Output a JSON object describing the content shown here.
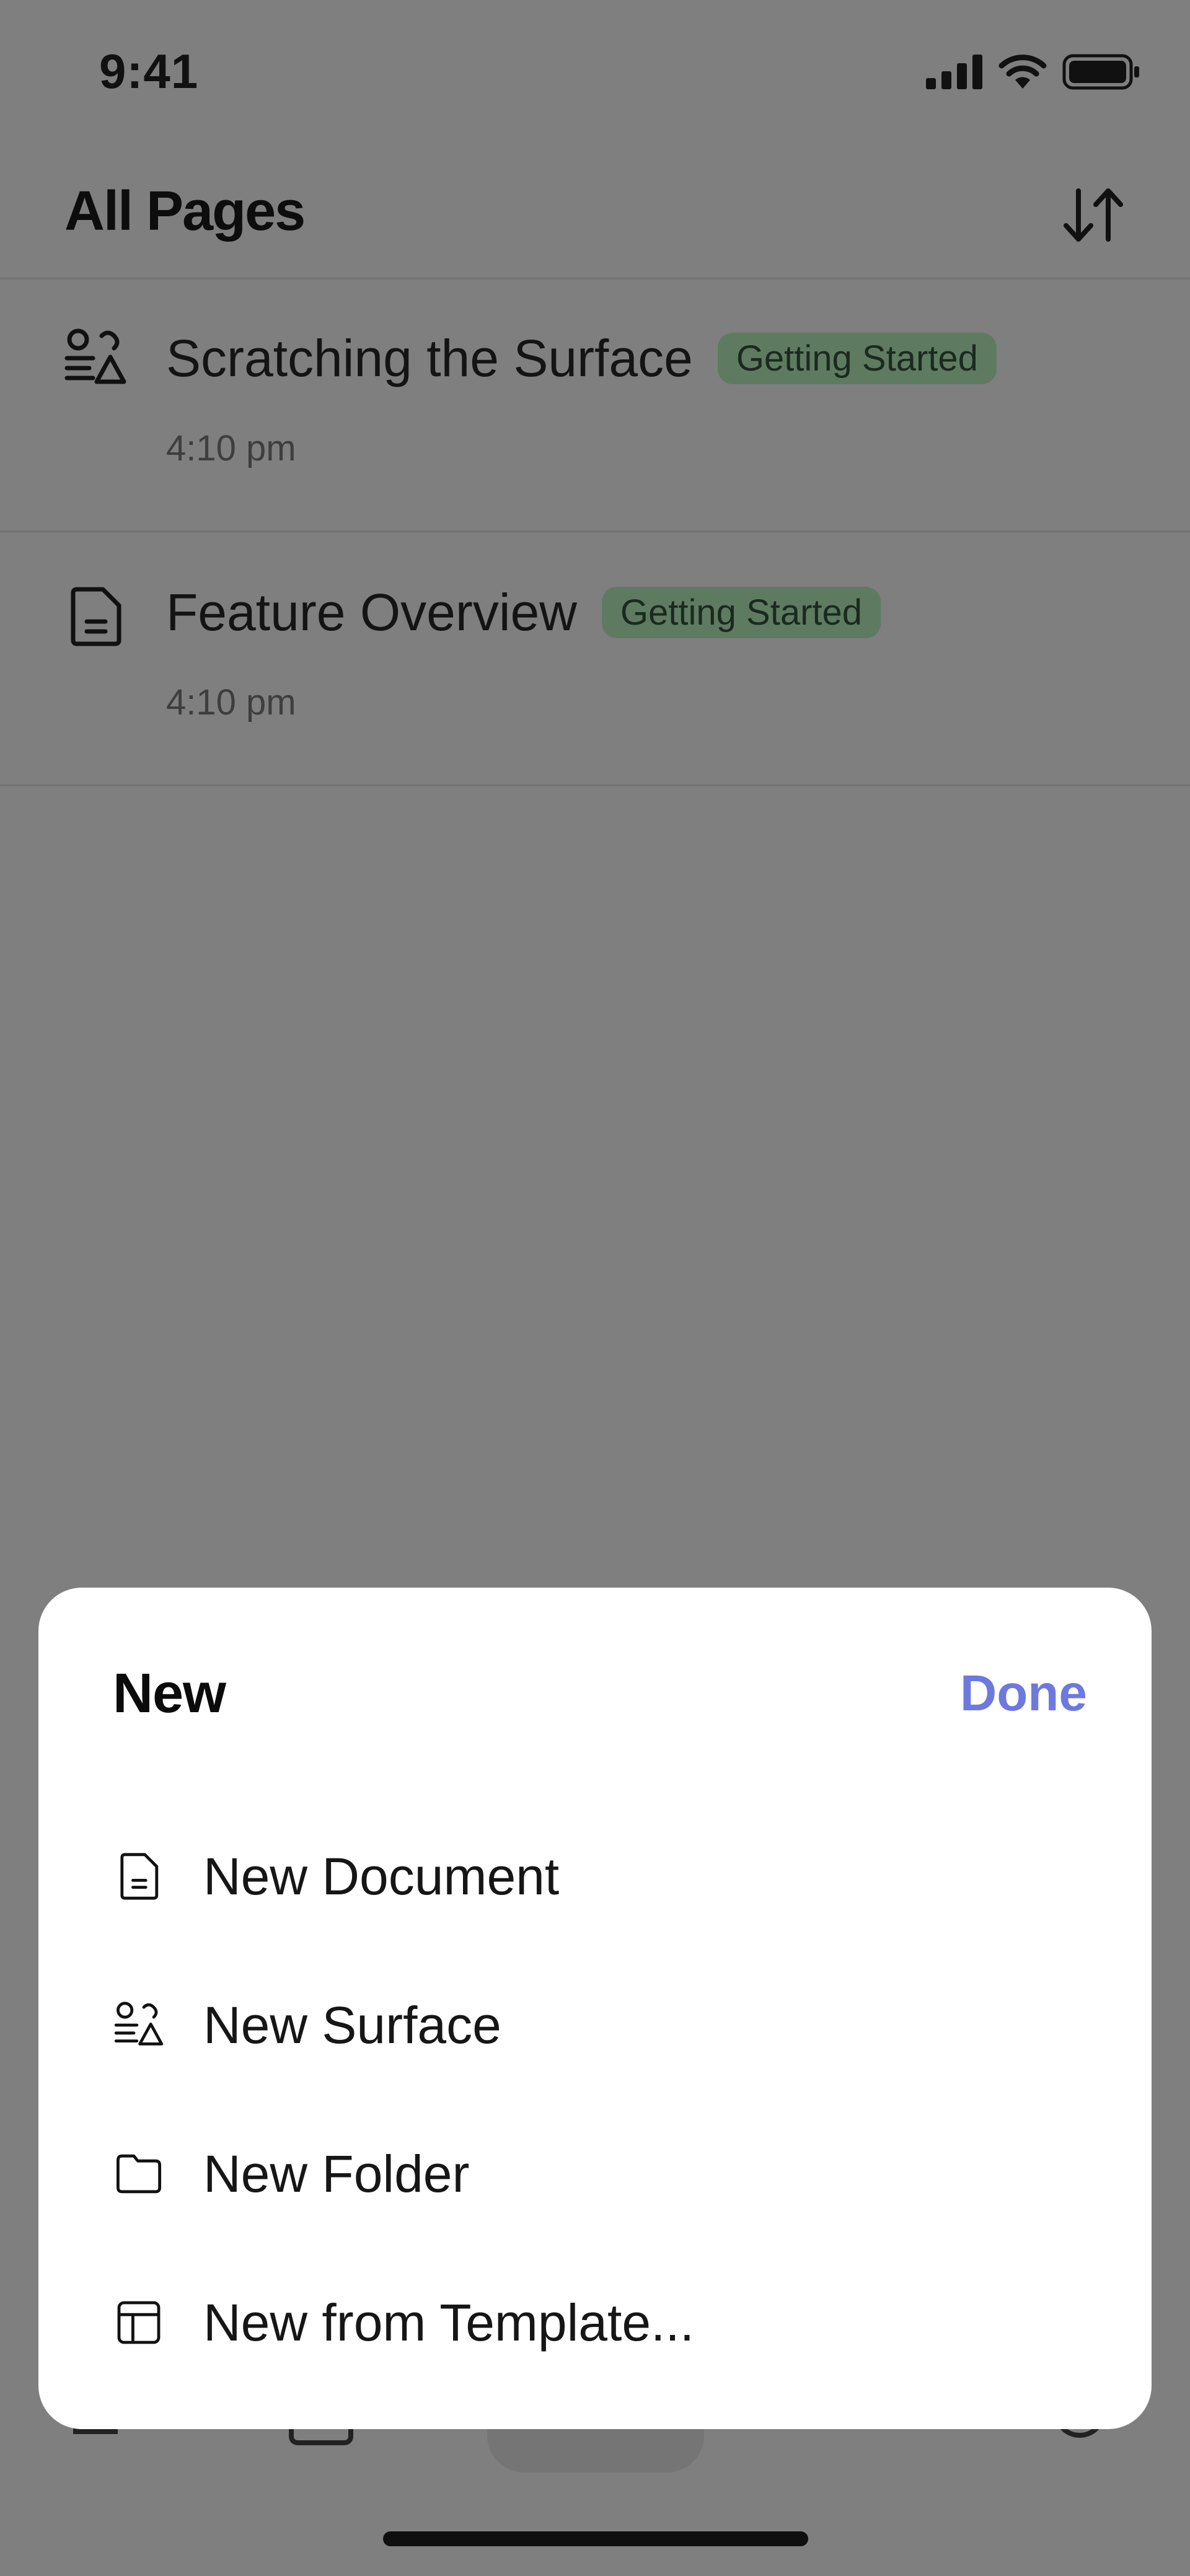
{
  "status_bar": {
    "time": "9:41"
  },
  "header": {
    "title": "All Pages"
  },
  "pages": [
    {
      "title": "Scratching the Surface",
      "tag": "Getting Started",
      "time": "4:10 pm",
      "icon": "surface-icon"
    },
    {
      "title": "Feature Overview",
      "tag": "Getting Started",
      "time": "4:10 pm",
      "icon": "document-icon"
    }
  ],
  "sheet": {
    "title": "New",
    "done_label": "Done",
    "items": [
      {
        "label": "New Document",
        "icon": "document-icon"
      },
      {
        "label": "New Surface",
        "icon": "surface-icon"
      },
      {
        "label": "New Folder",
        "icon": "folder-icon"
      },
      {
        "label": "New from Template...",
        "icon": "template-icon"
      }
    ]
  },
  "colors": {
    "accent": "#6e79df",
    "tag_bg": "#5e7b62",
    "scrim": "#7f7f7f"
  }
}
